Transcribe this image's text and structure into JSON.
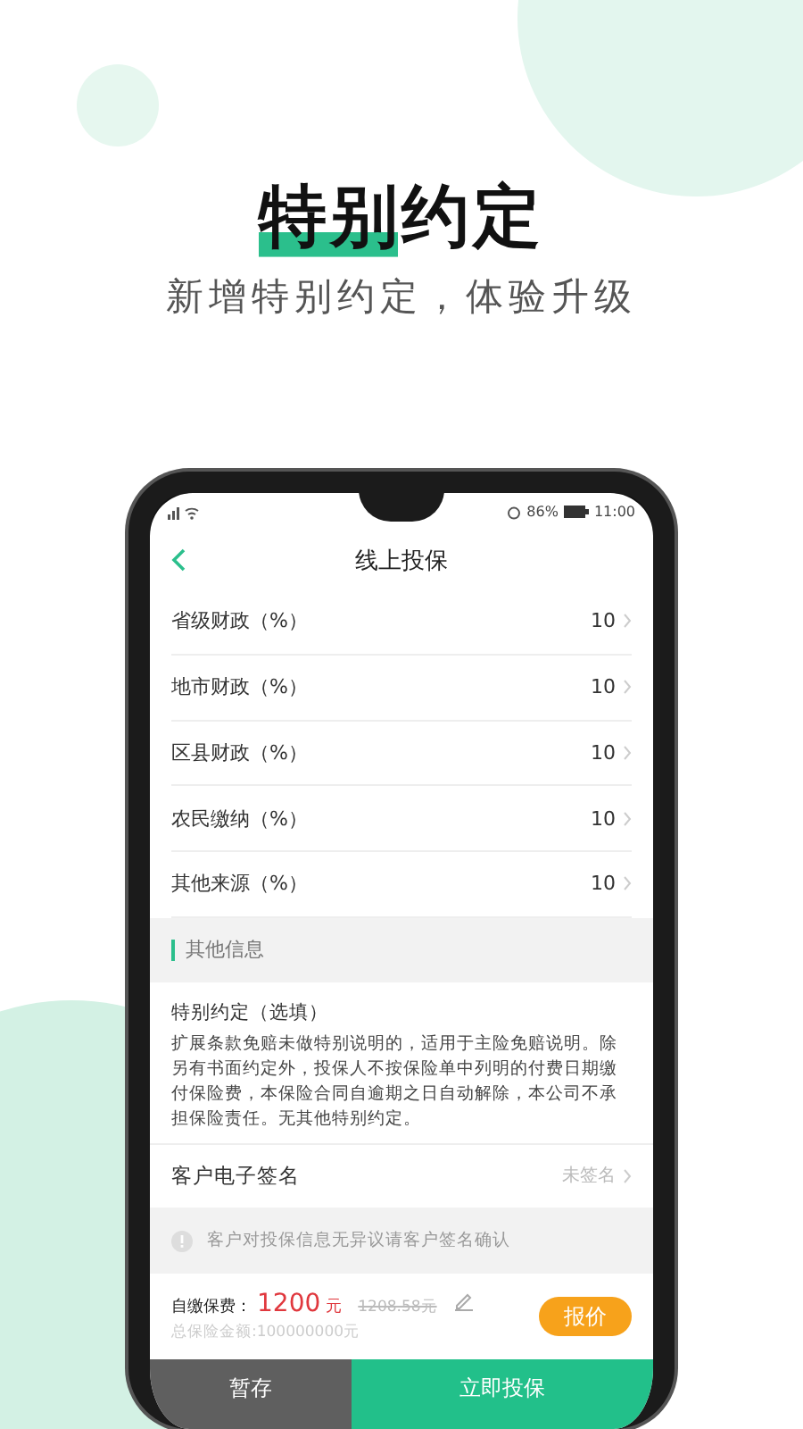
{
  "headline": "特别约定",
  "subtitle": "新增特别约定，体验升级",
  "status_bar": {
    "battery": "86%",
    "time": "11:00"
  },
  "nav": {
    "title": "线上投保"
  },
  "rows": [
    {
      "label": "省级财政（%）",
      "value": "10"
    },
    {
      "label": "地市财政（%）",
      "value": "10"
    },
    {
      "label": "区县财政（%）",
      "value": "10"
    },
    {
      "label": "农民缴纳（%）",
      "value": "10"
    },
    {
      "label": "其他来源（%）",
      "value": "10"
    }
  ],
  "section_title": "其他信息",
  "special": {
    "title": "特别约定（选填）",
    "text": "扩展条款免赔未做特别说明的，适用于主险免赔说明。除另有书面约定外，投保人不按保险单中列明的付费日期缴付保险费，本保险合同自逾期之日自动解除，本公司不承担保险责任。无其他特别约定。"
  },
  "signature": {
    "label": "客户电子签名",
    "value": "未签名"
  },
  "notice": "客户对投保信息无异议请客户签名确认",
  "price": {
    "label": "自缴保费：",
    "amount": "1200",
    "unit": "元",
    "original": "1208.58元",
    "total": "总保险金额:100000000元",
    "quote": "报价"
  },
  "buttons": [
    {
      "label": "暂存",
      "kind": "secondary"
    },
    {
      "label": "立即投保",
      "kind": "primary"
    }
  ]
}
